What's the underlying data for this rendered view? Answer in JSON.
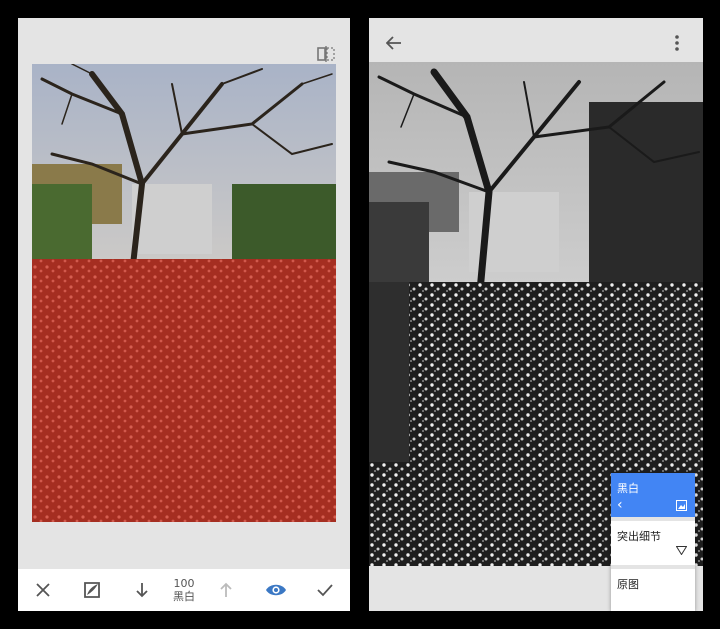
{
  "left_panel": {
    "compare_icon": "compare-split-icon",
    "toolbar": {
      "cancel_icon": "close-icon",
      "brush_icon": "brush-mask-icon",
      "decrease_icon": "arrow-down-icon",
      "value": "100",
      "mode_label": "黑白",
      "increase_icon": "arrow-up-icon",
      "view_mask_icon": "eye-icon",
      "apply_icon": "check-icon"
    },
    "colors": {
      "mask": "#cf2a1e",
      "accent": "#3b78c4"
    }
  },
  "right_panel": {
    "back_icon": "arrow-back-icon",
    "more_icon": "more-vert-icon",
    "menu": {
      "items": [
        {
          "label": "黑白",
          "selected": true
        },
        {
          "label": "突出细节",
          "selected": false
        },
        {
          "label": "原图",
          "selected": false
        }
      ]
    },
    "colors": {
      "menu_selected": "#4285f4"
    }
  }
}
